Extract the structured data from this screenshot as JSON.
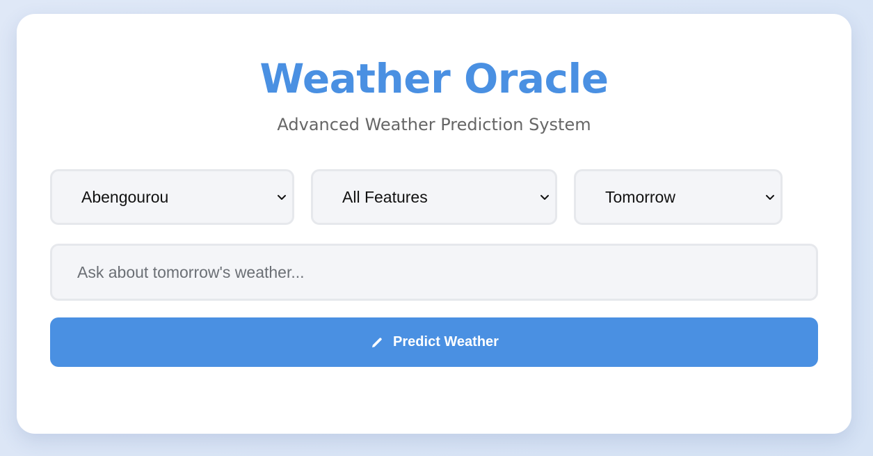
{
  "header": {
    "title": "Weather Oracle",
    "subtitle": "Advanced Weather Prediction System"
  },
  "controls": {
    "location": {
      "selected": "Abengourou",
      "icon": "chevron-down-icon"
    },
    "features": {
      "selected": "All Features",
      "icon": "chevron-down-icon"
    },
    "day": {
      "selected": "Tomorrow",
      "icon": "chevron-down-icon"
    }
  },
  "query": {
    "value": "",
    "placeholder": "Ask about tomorrow's weather..."
  },
  "predict_button": {
    "label": "Predict Weather",
    "icon": "pencil-icon"
  },
  "colors": {
    "accent": "#4a90e2",
    "background": "#dfe8f7",
    "card": "#ffffff",
    "field_bg": "#f4f5f8",
    "field_border": "#e6e8ec",
    "subtitle_text": "#666666"
  }
}
